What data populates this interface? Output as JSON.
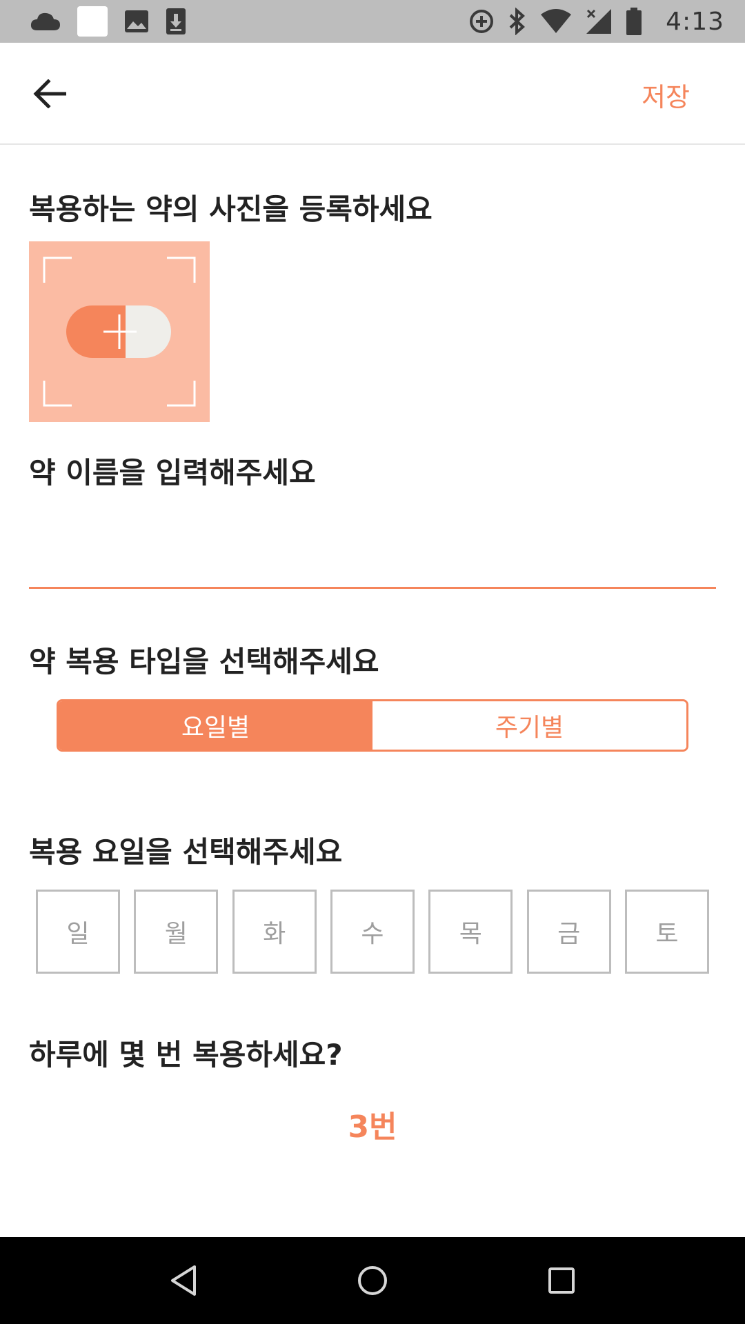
{
  "status_bar": {
    "time": "4:13",
    "left_icons": [
      "cloud-icon",
      "white-square-icon",
      "image-icon",
      "download-icon"
    ],
    "right_icons": [
      "data-saver-icon",
      "bluetooth-icon",
      "wifi-icon",
      "signal-icon",
      "battery-icon"
    ]
  },
  "app_bar": {
    "save_label": "저장"
  },
  "photo_section": {
    "title": "복용하는 약의 사진을 등록하세요"
  },
  "name_section": {
    "title": "약 이름을 입력해주세요",
    "value": "",
    "placeholder": ""
  },
  "type_section": {
    "title": "약 복용 타입을 선택해주세요",
    "options": [
      {
        "label": "요일별",
        "selected": true
      },
      {
        "label": "주기별",
        "selected": false
      }
    ]
  },
  "days_section": {
    "title": "복용 요일을 선택해주세요",
    "days": [
      "일",
      "월",
      "화",
      "수",
      "목",
      "금",
      "토"
    ]
  },
  "frequency_section": {
    "title": "하루에 몇 번 복용하세요?",
    "count_label": "3번"
  },
  "colors": {
    "accent": "#f5855b",
    "accent_light": "#fbbba3",
    "status_bar": "#bdbdbd",
    "nav_bar": "#000000"
  }
}
